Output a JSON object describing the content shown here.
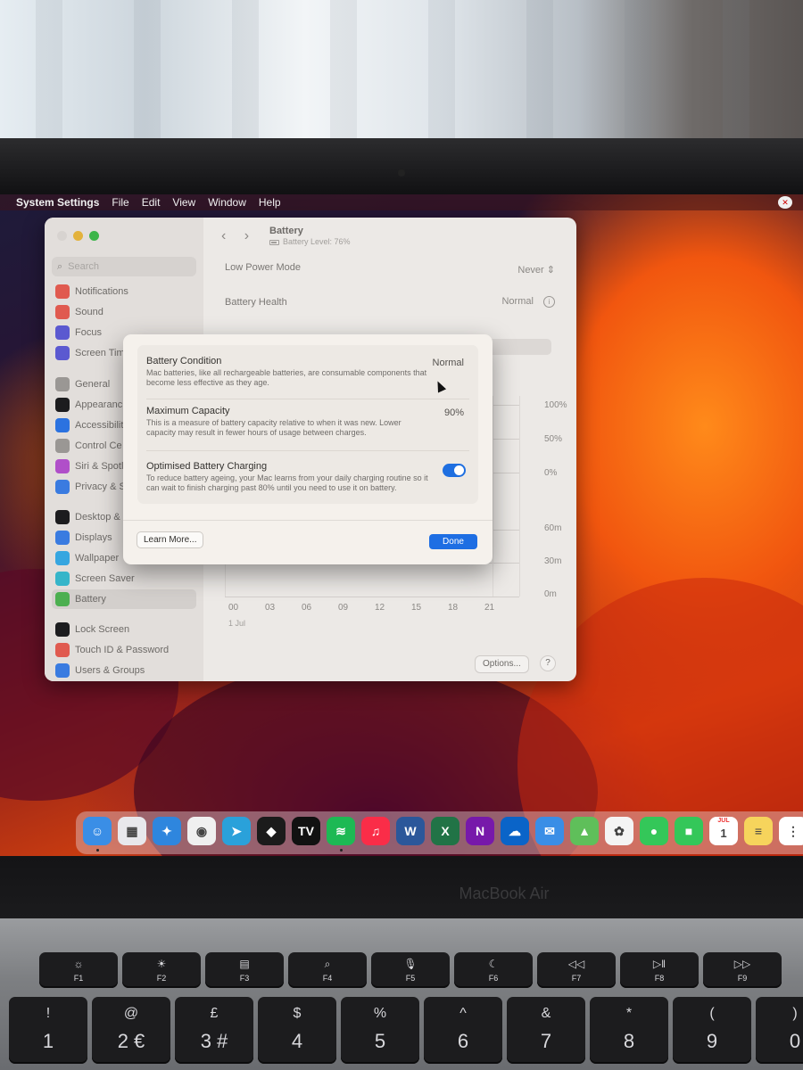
{
  "menubar": {
    "app_name": "System Settings",
    "items": [
      "File",
      "Edit",
      "View",
      "Window",
      "Help"
    ]
  },
  "sidebar": {
    "search_placeholder": "Search",
    "items": [
      {
        "label": "Notifications",
        "color": "#e05a4f",
        "icon": "bell-icon"
      },
      {
        "label": "Sound",
        "color": "#e05a4f",
        "icon": "speaker-icon"
      },
      {
        "label": "Focus",
        "color": "#5b59d0",
        "icon": "moon-icon"
      },
      {
        "label": "Screen Tim",
        "color": "#5b59d0",
        "icon": "hourglass-icon"
      },
      {
        "label": "General",
        "color": "#9a9794",
        "icon": "gear-icon"
      },
      {
        "label": "Appearanc",
        "color": "#1c1c1e",
        "icon": "appearance-icon"
      },
      {
        "label": "Accessibilit",
        "color": "#2b72e0",
        "icon": "accessibility-icon"
      },
      {
        "label": "Control Ce",
        "color": "#9a9794",
        "icon": "control-center-icon"
      },
      {
        "label": "Siri & Spotl",
        "color": "#b04fc9",
        "icon": "siri-icon"
      },
      {
        "label": "Privacy & S",
        "color": "#3a7be0",
        "icon": "hand-icon"
      },
      {
        "label": "Desktop &",
        "color": "#1c1c1e",
        "icon": "desktop-icon"
      },
      {
        "label": "Displays",
        "color": "#3a7be0",
        "icon": "display-icon"
      },
      {
        "label": "Wallpaper",
        "color": "#36a6e0",
        "icon": "wallpaper-icon"
      },
      {
        "label": "Screen Saver",
        "color": "#36b5c9",
        "icon": "screensaver-icon"
      },
      {
        "label": "Battery",
        "color": "#4caf50",
        "icon": "battery-icon"
      },
      {
        "label": "Lock Screen",
        "color": "#1c1c1e",
        "icon": "lock-icon"
      },
      {
        "label": "Touch ID & Password",
        "color": "#e05a4f",
        "icon": "fingerprint-icon"
      },
      {
        "label": "Users & Groups",
        "color": "#3a7be0",
        "icon": "users-icon"
      }
    ]
  },
  "content": {
    "title": "Battery",
    "subtitle": "Battery Level: 76%",
    "low_power_label": "Low Power Mode",
    "low_power_value": "Never",
    "health_label": "Battery Health",
    "health_value": "Normal",
    "y_labels_top": [
      "100%",
      "50%",
      "0%"
    ],
    "y_labels_bottom": [
      "60m",
      "30m",
      "0m"
    ],
    "x_labels": [
      "00",
      "03",
      "06",
      "09",
      "12",
      "15",
      "18",
      "21"
    ],
    "x_date": "1 Jul",
    "options_label": "Options...",
    "help_label": "?"
  },
  "sheet": {
    "condition_title": "Battery Condition",
    "condition_desc": "Mac batteries, like all rechargeable batteries, are consumable components that become less effective as they age.",
    "condition_value": "Normal",
    "capacity_title": "Maximum Capacity",
    "capacity_desc": "This is a measure of battery capacity relative to when it was new. Lower capacity may result in fewer hours of usage between charges.",
    "capacity_value": "90%",
    "optimised_title": "Optimised Battery Charging",
    "optimised_desc": "To reduce battery ageing, your Mac learns from your daily charging routine so it can wait to finish charging past 80% until you need to use it on battery.",
    "optimised_enabled": true,
    "learn_more_label": "Learn More...",
    "done_label": "Done"
  },
  "dock": {
    "apps": [
      {
        "name": "finder-icon",
        "color": "#3a8ee6",
        "glyph": "☺"
      },
      {
        "name": "launchpad-icon",
        "color": "#e8e8ec",
        "glyph": "▦"
      },
      {
        "name": "safari-icon",
        "color": "#2e86de",
        "glyph": "✦"
      },
      {
        "name": "chrome-icon",
        "color": "#f0f0f0",
        "glyph": "◉"
      },
      {
        "name": "telegram-icon",
        "color": "#2aa1da",
        "glyph": "➤"
      },
      {
        "name": "binance-icon",
        "color": "#1b1b1b",
        "glyph": "◆"
      },
      {
        "name": "tradingview-icon",
        "color": "#111111",
        "glyph": "TV"
      },
      {
        "name": "spotify-icon",
        "color": "#1db954",
        "glyph": "≋"
      },
      {
        "name": "music-icon",
        "color": "#fa2d48",
        "glyph": "♫"
      },
      {
        "name": "word-icon",
        "color": "#2b579a",
        "glyph": "W"
      },
      {
        "name": "excel-icon",
        "color": "#217346",
        "glyph": "X"
      },
      {
        "name": "onenote-icon",
        "color": "#7719aa",
        "glyph": "N"
      },
      {
        "name": "onedrive-icon",
        "color": "#0a64c8",
        "glyph": "☁"
      },
      {
        "name": "mail-icon",
        "color": "#3a8ee6",
        "glyph": "✉"
      },
      {
        "name": "maps-icon",
        "color": "#5fbf5a",
        "glyph": "▲"
      },
      {
        "name": "photos-icon",
        "color": "#f4f4f4",
        "glyph": "✿"
      },
      {
        "name": "messages-icon",
        "color": "#34c759",
        "glyph": "●"
      },
      {
        "name": "facetime-icon",
        "color": "#34c759",
        "glyph": "■"
      },
      {
        "name": "calendar-icon",
        "color": "#ffffff",
        "glyph": "1"
      },
      {
        "name": "notes-icon",
        "color": "#f6d45c",
        "glyph": "≡"
      },
      {
        "name": "reminders-icon",
        "color": "#ffffff",
        "glyph": "⋮"
      }
    ],
    "calendar_month": "JUL"
  },
  "device": {
    "brand": "MacBook Air",
    "fn_keys": [
      {
        "icon": "☼",
        "label": "F1"
      },
      {
        "icon": "☀",
        "label": "F2"
      },
      {
        "icon": "▤",
        "label": "F3"
      },
      {
        "icon": "⌕",
        "label": "F4"
      },
      {
        "icon": "🎙",
        "label": "F5"
      },
      {
        "icon": "☾",
        "label": "F6"
      },
      {
        "icon": "◁◁",
        "label": "F7"
      },
      {
        "icon": "▷‖",
        "label": "F8"
      },
      {
        "icon": "▷▷",
        "label": "F9"
      }
    ],
    "number_keys": [
      {
        "top": "!",
        "bottom": "1"
      },
      {
        "top": "@",
        "bottom": "2 €"
      },
      {
        "top": "£",
        "bottom": "3 #"
      },
      {
        "top": "$",
        "bottom": "4"
      },
      {
        "top": "%",
        "bottom": "5"
      },
      {
        "top": "^",
        "bottom": "6"
      },
      {
        "top": "&",
        "bottom": "7"
      },
      {
        "top": "*",
        "bottom": "8"
      },
      {
        "top": "(",
        "bottom": "9"
      },
      {
        "top": ")",
        "bottom": "0"
      }
    ]
  }
}
